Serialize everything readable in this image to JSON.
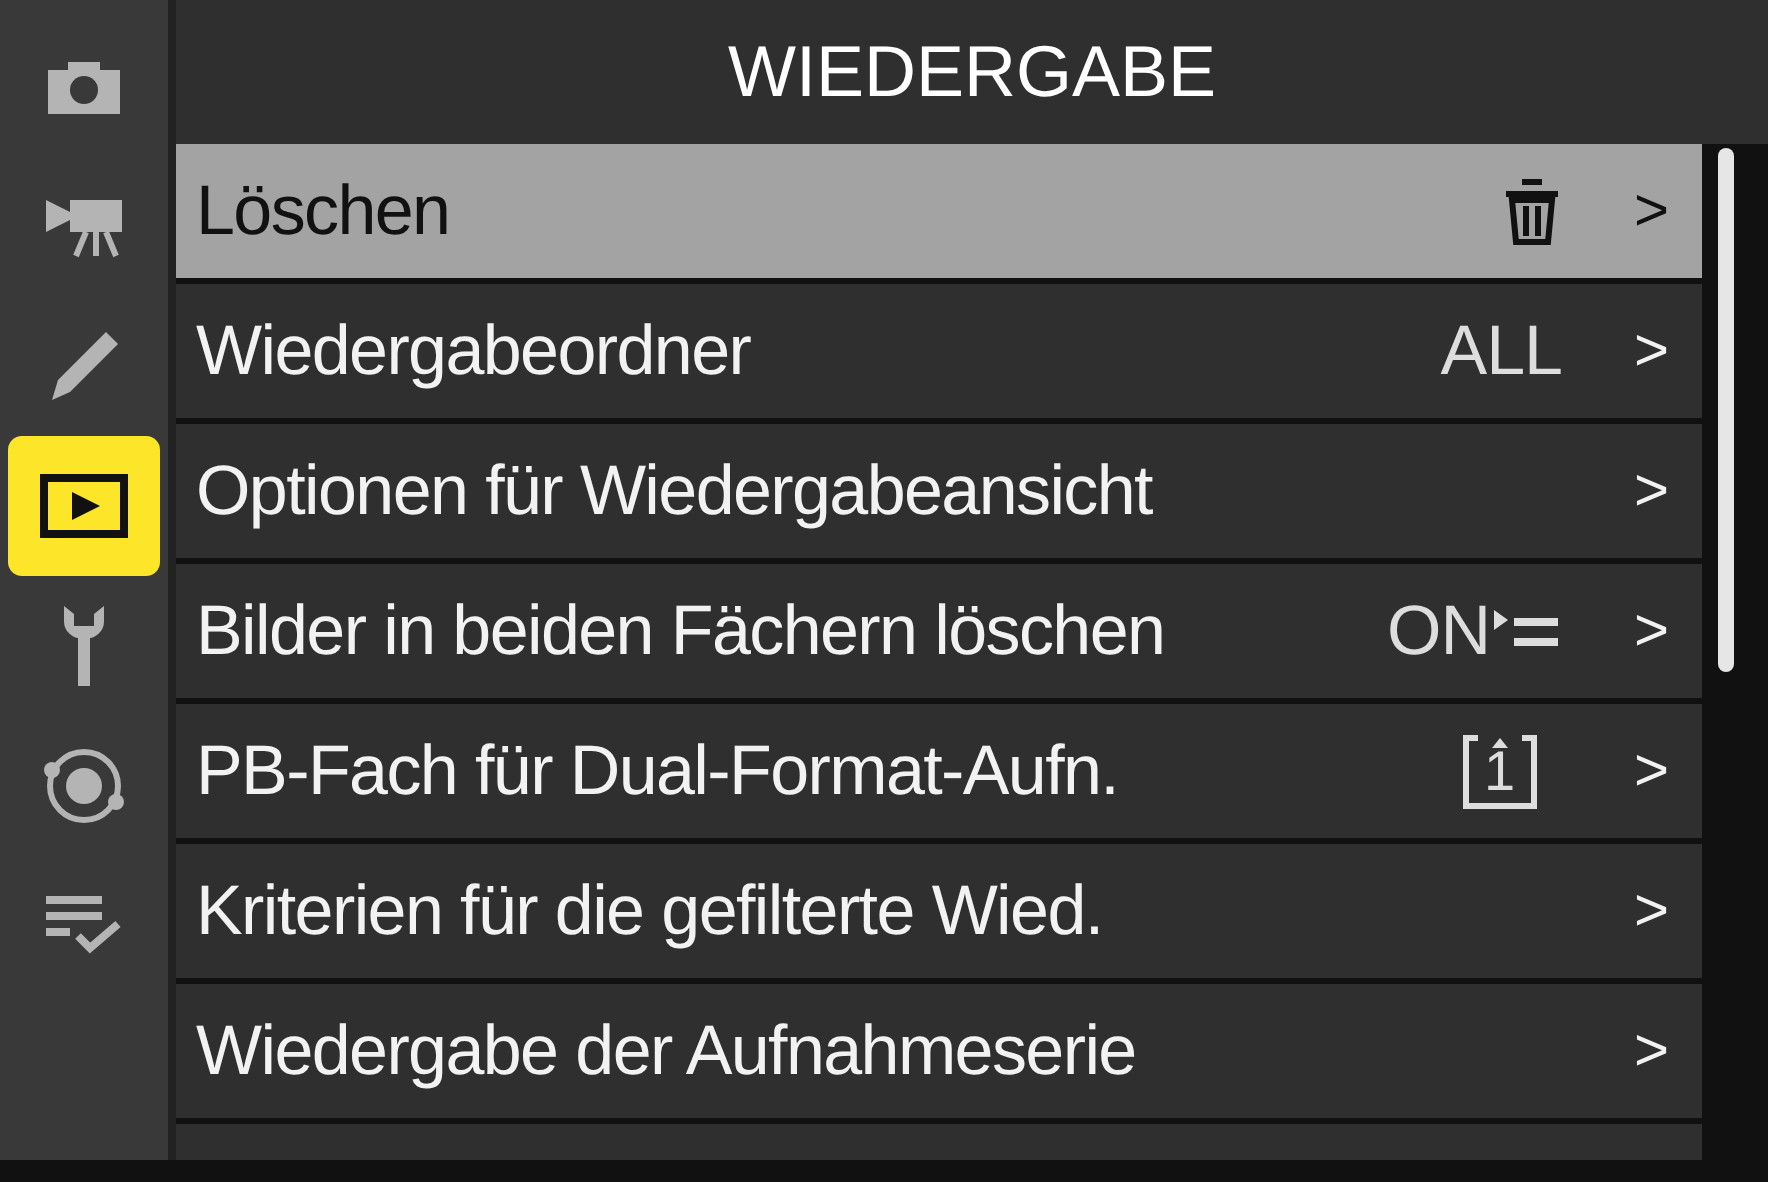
{
  "title": "WIEDERGABE",
  "sidebar": [
    {
      "kind": "camera",
      "selected": false
    },
    {
      "kind": "movie",
      "selected": false
    },
    {
      "kind": "pencil",
      "selected": false
    },
    {
      "kind": "playback",
      "selected": true
    },
    {
      "kind": "wrench",
      "selected": false
    },
    {
      "kind": "network",
      "selected": false
    },
    {
      "kind": "mymenu",
      "selected": false
    }
  ],
  "rows": [
    {
      "label": "Löschen",
      "selected": true,
      "value": {
        "kind": "trash"
      }
    },
    {
      "label": "Wiedergabeordner",
      "selected": false,
      "value": {
        "kind": "text",
        "text": "ALL"
      }
    },
    {
      "label": "Optionen für Wiedergabeansicht",
      "selected": false
    },
    {
      "label": "Bilder in beiden Fächern löschen",
      "selected": false,
      "value": {
        "kind": "on-list",
        "text": "ON"
      }
    },
    {
      "label": "PB-Fach für Dual-Format-Aufn.",
      "selected": false,
      "value": {
        "kind": "slot",
        "text": "1"
      }
    },
    {
      "label": "Kriterien für die gefilterte Wied.",
      "selected": false
    },
    {
      "label": "Wiedergabe der Aufnahmeserie",
      "selected": false
    }
  ],
  "arrow": ">"
}
